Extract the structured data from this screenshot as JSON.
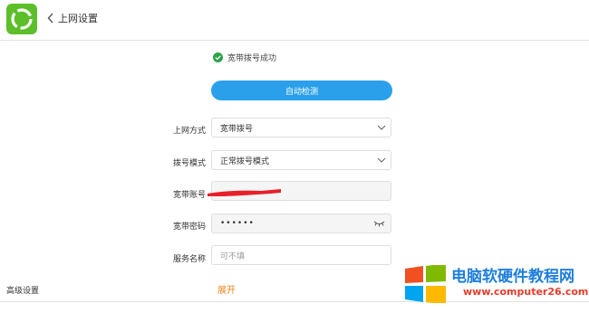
{
  "header": {
    "title": "上网设置"
  },
  "status": {
    "text": "宽带拨号成功",
    "color": "#2ca24a"
  },
  "detect_button": {
    "label": "自动检测",
    "color": "#2aa0ea"
  },
  "form": {
    "connection_type": {
      "label": "上网方式",
      "value": "宽带拨号"
    },
    "dial_mode": {
      "label": "拨号模式",
      "value": "正常拨号模式"
    },
    "account": {
      "label": "宽带账号",
      "value": ""
    },
    "password": {
      "label": "宽带密码",
      "value": "••••••"
    },
    "service_name": {
      "label": "服务名称",
      "placeholder": "可不填"
    }
  },
  "advanced": {
    "label": "高级设置",
    "toggle": "展开",
    "toggle_color": "#f08519"
  },
  "watermark": {
    "title": "电脑软硬件教程网",
    "url": "www.computer26.com"
  },
  "icons": [
    "app-logo-icon",
    "back-arrow-icon",
    "check-circle-icon",
    "chevron-down-icon",
    "eye-closed-icon",
    "windows-logo-icon"
  ]
}
